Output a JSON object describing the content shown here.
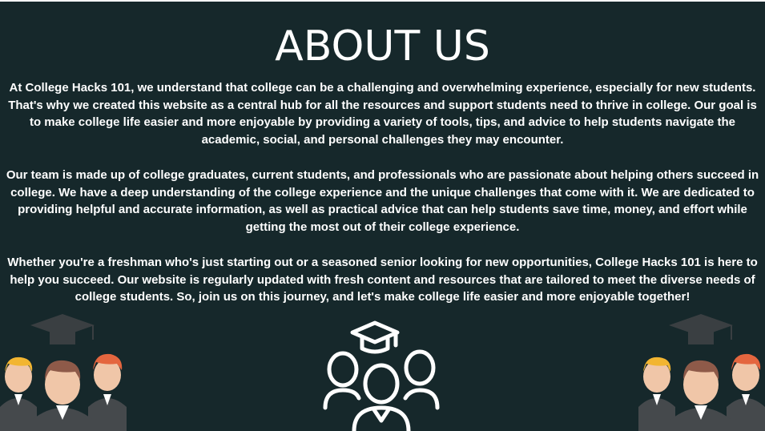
{
  "page": {
    "title": "ABOUT US",
    "paragraphs": [
      "At College Hacks 101, we understand that college can be a challenging and overwhelming experience, especially for new students. That's why we created this website as a central hub for all the resources and support students need to thrive in college. Our goal is to make college life easier and more enjoyable by providing a variety of tools, tips, and advice to help students navigate the academic, social, and personal challenges they may encounter.",
      "Our team is made up of college graduates, current students, and professionals who are passionate about helping others succeed in college. We have a deep understanding of the college experience and the unique challenges that come with it. We are dedicated to providing helpful and accurate information, as well as practical advice that can help students save time, money, and effort while getting the most out of their college experience.",
      "Whether you're a freshman who's just starting out or a seasoned senior looking for new opportunities, College Hacks 101 is here to help you succeed. Our website is regularly updated with fresh content and resources that are tailored to meet the diverse needs of college students. So, join us on this journey, and let's make college life easier and more enjoyable together!"
    ]
  },
  "colors": {
    "background": "#16282b",
    "text": "#ffffff",
    "cap": "#3a3f42",
    "skin": "#f0c6a8",
    "suit": "#45494c",
    "hair_red": "#e4663f",
    "hair_yellow": "#f2b531",
    "hair_brown": "#8e5a49"
  },
  "illustrations": {
    "left": "graduates-group-icon",
    "center": "graduates-outline-icon",
    "right": "graduates-group-icon"
  }
}
